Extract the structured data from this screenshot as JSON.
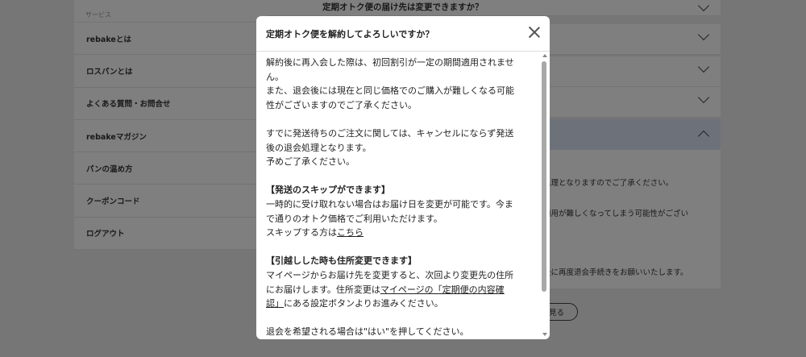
{
  "sidebar": {
    "section_label": "サービス",
    "items": [
      {
        "label": "rebakeとは"
      },
      {
        "label": "ロスパンとは"
      },
      {
        "label": "よくある質問・お問合せ"
      },
      {
        "label": "rebakeマガジン"
      },
      {
        "label": "パンの温め方"
      },
      {
        "label": "クーポンコード"
      },
      {
        "label": "ログアウト"
      }
    ]
  },
  "faq": {
    "first_question": "定期オトク便の届け先は変更できますか？",
    "answer_lines": [
      "処理となりますのでご了承ください。",
      "適用が難しくなってしまう可能性がござい",
      "後に再度退会手続きをお願いいたします。"
    ],
    "button_label": "見る"
  },
  "modal": {
    "title": "定期オトク便を解約してよろしいですか？",
    "paragraphs": {
      "p1_l1": "解約後に再入会した際は、初回割引が一定の期間適用されませ",
      "p1_l2": "ん。",
      "p1_l3": "また、退会後には現在と同じ価格でのご購入が難しくなる可能",
      "p1_l4": "性がございますのでご了承ください。",
      "p2_l1": "すでに発送待ちのご注文に関しては、キャンセルにならず発送",
      "p2_l2": "後の退会処理となります。",
      "p2_l3": "予めご了承ください。",
      "skip_heading": "【発送のスキップができます】",
      "skip_l1": "一時的に受け取れない場合はお届け日を変更が可能です。今ま",
      "skip_l2": "で通りのオトク価格でご利用いただけます。",
      "skip_l3_prefix": "スキップする方は",
      "skip_link": "こちら",
      "move_heading": "【引越しした時も住所変更できます】",
      "move_l1": "マイページからお届け先を変更すると、次回より変更先の住所",
      "move_l2_prefix": "にお届けします。住所変更は",
      "move_link_l1": "マイページの「定期便の内容確",
      "move_link_l2": "認」",
      "move_l3_suffix": "にある設定ボタンよりお進みください。",
      "final": "退会を希望される場合は\"はい\"を押してください。"
    }
  }
}
